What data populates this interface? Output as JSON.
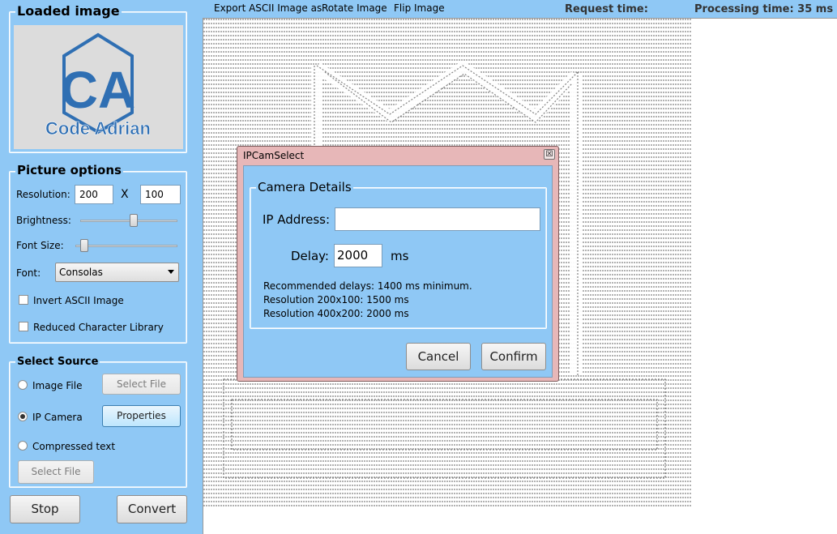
{
  "loaded_image": {
    "title": "Loaded image",
    "logo_letters": "CA",
    "logo_caption": "Code Adrian"
  },
  "picture_options": {
    "title": "Picture options",
    "resolution_label": "Resolution:",
    "resolution_width": "200",
    "resolution_x": "X",
    "resolution_height": "100",
    "brightness_label": "Brightness:",
    "brightness_level": 0.55,
    "font_size_label": "Font Size:",
    "font_size_level": 0.05,
    "font_label": "Font:",
    "font_value": "Consolas",
    "invert_label": "Invert ASCII Image",
    "reduced_label": "Reduced Character Library"
  },
  "select_source": {
    "title": "Select Source",
    "image_file_label": "Image File",
    "image_select_button": "Select File",
    "ip_camera_label": "IP Camera",
    "properties_button": "Properties",
    "compressed_label": "Compressed text",
    "compressed_select_button": "Select File"
  },
  "actions": {
    "stop": "Stop",
    "convert": "Convert"
  },
  "menu": {
    "export": "Export ASCII Image as",
    "rotate": "Rotate Image",
    "flip": "Flip Image"
  },
  "status": {
    "request_label": "Request time:",
    "processing_label": "Processing time: 35 ms"
  },
  "dialog": {
    "title": "IPCamSelect",
    "close_glyph": "☒",
    "group_title": "Camera Details",
    "ip_label": "IP Address:",
    "ip_value": "",
    "delay_label": "Delay:",
    "delay_value": "2000",
    "delay_unit": "ms",
    "note_1": "Recommended delays: 1400 ms minimum.",
    "note_2": "Resolution 200x100: 1500 ms",
    "note_3": "Resolution 400x200: 2000 ms",
    "cancel": "Cancel",
    "confirm": "Confirm"
  },
  "colors": {
    "window_bg": "#8fc8f5",
    "dialog_frame": "#e7b7b8",
    "logo_blue": "#2f6fb3"
  }
}
